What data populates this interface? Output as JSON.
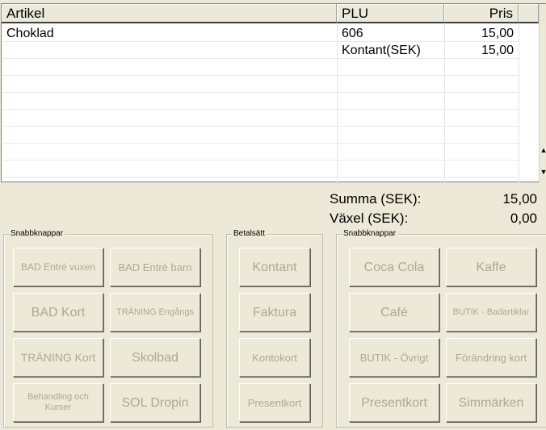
{
  "grid": {
    "headers": {
      "artikel": "Artikel",
      "plu": "PLU",
      "pris": "Pris"
    },
    "rows": [
      {
        "artikel": "Choklad",
        "plu": "606",
        "pris": "15,00"
      },
      {
        "artikel": "",
        "plu": "Kontant(SEK)",
        "pris": "15,00"
      }
    ],
    "scroll_up": "▲",
    "scroll_down": "▼"
  },
  "totals": {
    "summa_label": "Summa (SEK):",
    "summa_value": "15,00",
    "vaxel_label": "Växel (SEK):",
    "vaxel_value": "0,00"
  },
  "left_group": {
    "title": "Snabbknappar",
    "buttons": [
      "BAD Entré vuxen",
      "BAD Entré barn",
      "BAD Kort",
      "TRÄNING Engångs",
      "TRÄNING Kort",
      "Skolbad",
      "Behandling och Kurser",
      "SOL Dropin"
    ]
  },
  "pay_group": {
    "title": "Betalsätt",
    "buttons": [
      "Kontant",
      "Faktura",
      "Kontokort",
      "Presentkort"
    ]
  },
  "right_group": {
    "title": "Snabbknappar",
    "buttons": [
      "Coca Cola",
      "Kaffe",
      "Café",
      "BUTIK - Badartiklar",
      "BUTIK - Övrigt",
      "Förändring kort",
      "Presentkort",
      "Simmärken"
    ]
  },
  "colors": {
    "background": "#ece9d8",
    "disabled_text": "#aca899"
  }
}
